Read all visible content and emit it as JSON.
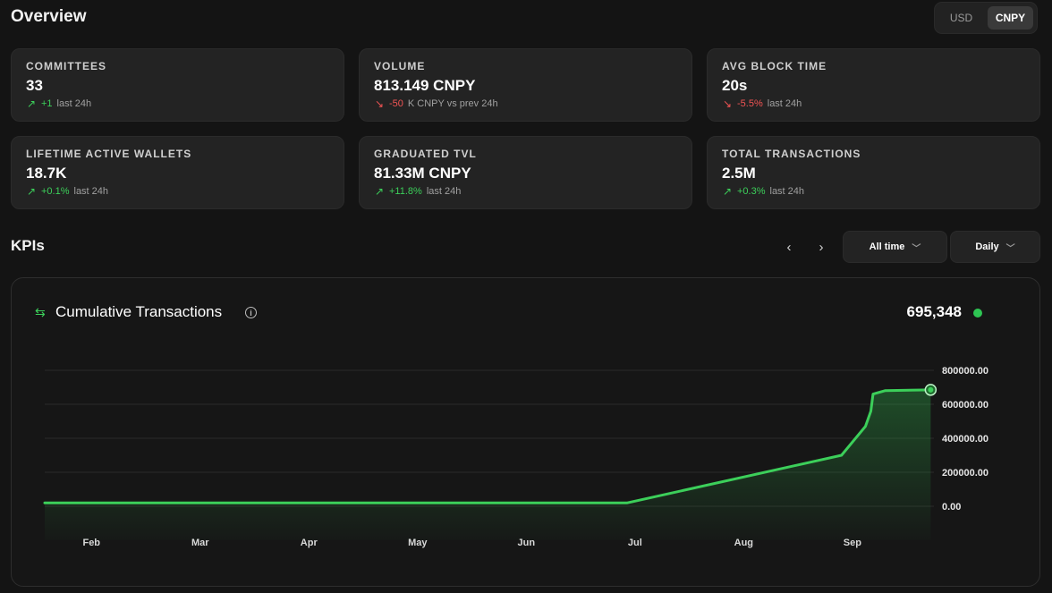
{
  "header": {
    "title": "Overview"
  },
  "currency": {
    "options": [
      "USD",
      "CNPY"
    ],
    "selected": "CNPY"
  },
  "stats": [
    {
      "label": "COMMITTEES",
      "value": "33",
      "direction": "up",
      "change": "+1",
      "note": "last 24h"
    },
    {
      "label": "VOLUME",
      "value": "813.149 CNPY",
      "direction": "down",
      "change": "-50",
      "note": "K CNPY vs prev 24h"
    },
    {
      "label": "AVG BLOCK TIME",
      "value": "20s",
      "direction": "down",
      "change": "-5.5%",
      "note": "last 24h"
    },
    {
      "label": "LIFETIME ACTIVE WALLETS",
      "value": "18.7K",
      "direction": "up",
      "change": "+0.1%",
      "note": "last 24h"
    },
    {
      "label": "GRADUATED TVL",
      "value": "81.33M CNPY",
      "direction": "up",
      "change": "+11.8%",
      "note": "last 24h"
    },
    {
      "label": "TOTAL TRANSACTIONS",
      "value": "2.5M",
      "direction": "up",
      "change": "+0.3%",
      "note": "last 24h"
    }
  ],
  "kpis": {
    "title": "KPIs",
    "nav": {
      "prev": "‹",
      "next": "›"
    },
    "range": {
      "label": "All time",
      "icon": "chevron-down-icon"
    },
    "interval": {
      "label": "Daily",
      "icon": "chevron-down-icon"
    }
  },
  "chart_card": {
    "icon": "swap-arrows-icon",
    "title": "Cumulative Transactions",
    "info_icon": "info-icon",
    "current_value": "695,348"
  },
  "colors": {
    "background": "#141414",
    "card": "#232323",
    "accent_green": "#3ccf5a",
    "negative_red": "#f25454"
  },
  "chart_data": {
    "type": "area",
    "title": "Cumulative Transactions",
    "x_tick_labels": [
      "Feb",
      "Mar",
      "Apr",
      "May",
      "Jun",
      "Jul",
      "Aug",
      "Sep"
    ],
    "y_tick_labels": [
      "800000.00",
      "600000.00",
      "400000.00",
      "200000.00",
      "0.00"
    ],
    "y_ticks": [
      800000,
      600000,
      400000,
      200000,
      0
    ],
    "ylim": [
      -200000,
      800000
    ],
    "x_unit": "month index (Feb = 1)",
    "series": [
      {
        "points": [
          {
            "x": 0.57,
            "y": 20000
          },
          {
            "x": 5.6,
            "y": 20000
          },
          {
            "x": 5.93,
            "y": 20000
          },
          {
            "x": 7.9,
            "y": 300000
          },
          {
            "x": 8.12,
            "y": 470000
          },
          {
            "x": 8.17,
            "y": 560000
          },
          {
            "x": 8.19,
            "y": 660000
          },
          {
            "x": 8.3,
            "y": 680000
          },
          {
            "x": 8.72,
            "y": 685000
          }
        ]
      }
    ],
    "grid": true,
    "y_axis_position": "right",
    "last_point_marker": true
  }
}
